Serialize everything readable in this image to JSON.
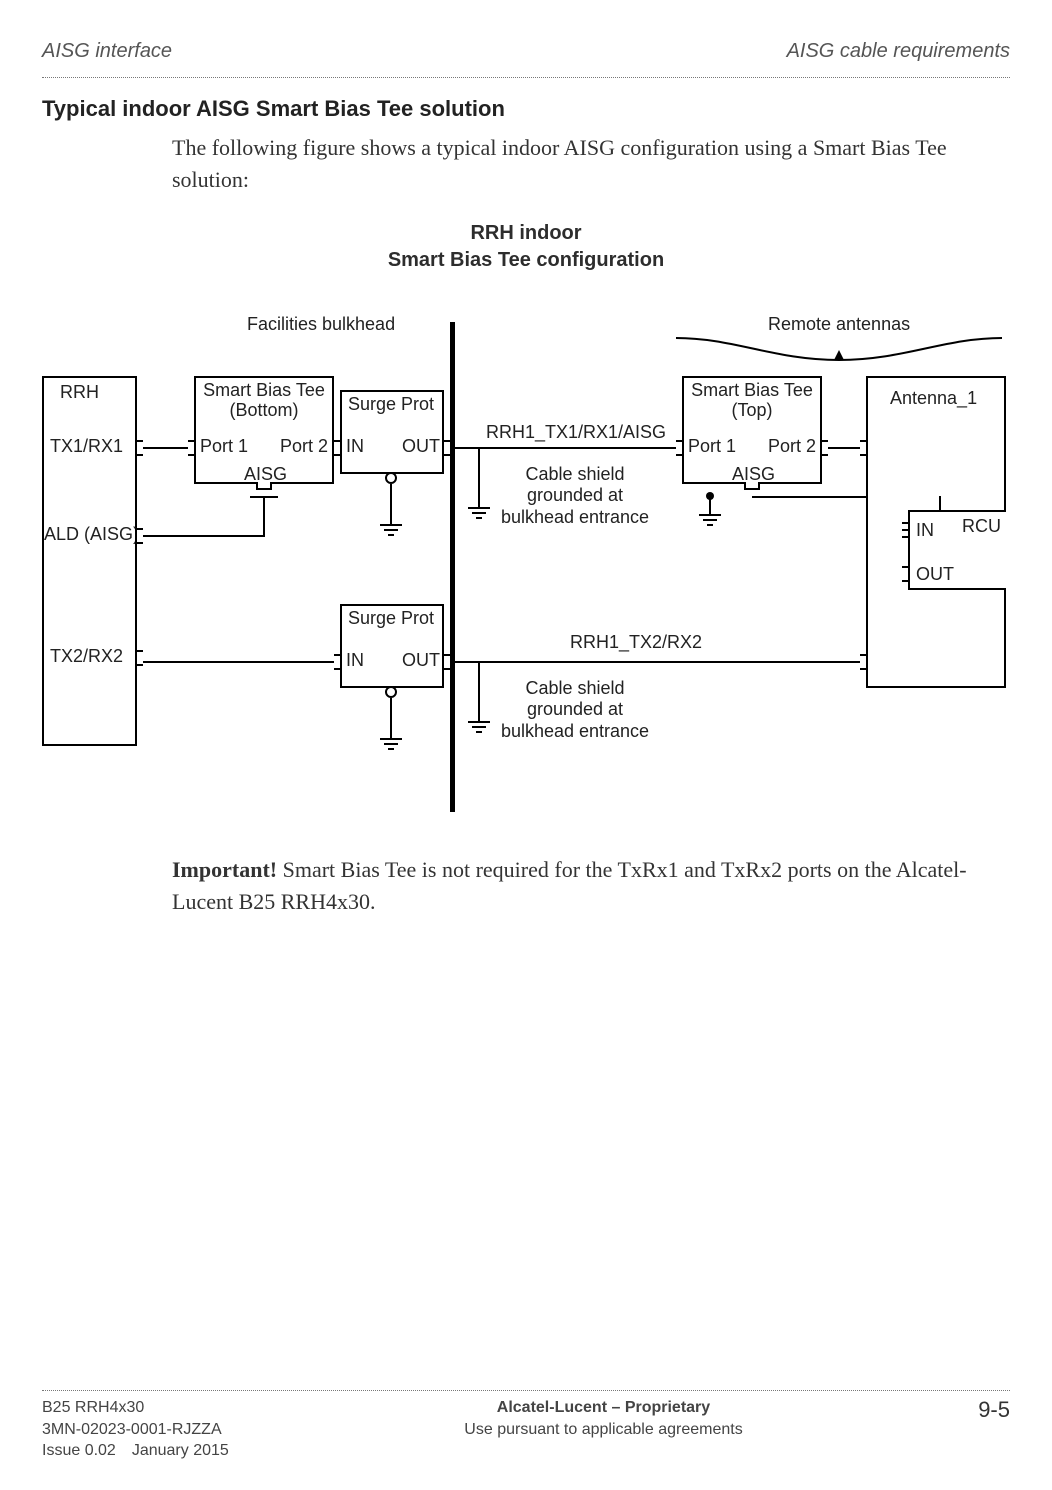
{
  "header": {
    "left": "AISG interface",
    "right": "AISG cable requirements"
  },
  "section": {
    "title": "Typical indoor AISG Smart Bias Tee solution",
    "intro": "The following figure shows a typical indoor AISG configuration using a Smart Bias Tee solution:"
  },
  "figure": {
    "title_line1": "RRH indoor",
    "title_line2": "Smart Bias Tee configuration",
    "labels": {
      "facilities_bulkhead": "Facilities bulkhead",
      "remote_antennas": "Remote antennas",
      "rrh": "RRH",
      "tx1rx1": "TX1/RX1",
      "ald_aisg": "ALD (AISG)",
      "tx2rx2": "TX2/RX2",
      "sbt_bottom_l1": "Smart Bias Tee",
      "sbt_bottom_l2": "(Bottom)",
      "sbt_top_l1": "Smart Bias Tee",
      "sbt_top_l2": "(Top)",
      "port1": "Port 1",
      "port2": "Port 2",
      "aisg": "AISG",
      "surge_prot": "Surge Prot",
      "in": "IN",
      "out": "OUT",
      "antenna_1": "Antenna_1",
      "rcu": "RCU",
      "rrh1_tx1": "RRH1_TX1/RX1/AISG",
      "rrh1_tx2": "RRH1_TX2/RX2",
      "cable_shield_l1": "Cable shield",
      "cable_shield_l2": "grounded at",
      "cable_shield_l3": "bulkhead entrance"
    }
  },
  "important": {
    "lead": "Important!",
    "text": " Smart Bias Tee is not required for the TxRx1 and TxRx2 ports on the Alcatel-Lucent B25 RRH4x30."
  },
  "footer": {
    "left_l1": "B25 RRH4x30",
    "left_l2": "3MN-02023-0001-RJZZA",
    "left_l3": "Issue 0.02 January 2015",
    "center_l1": "Alcatel-Lucent – Proprietary",
    "center_l2": "Use pursuant to applicable agreements",
    "page_no": "9-5"
  }
}
